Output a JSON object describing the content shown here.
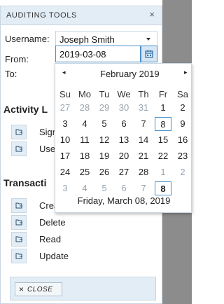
{
  "panel": {
    "title": "AUDITING TOOLS",
    "close_glyph": "×"
  },
  "form": {
    "username_label": "Username:",
    "username_value": "Joseph Smith",
    "from_label": "From:",
    "from_value": "2019-03-08",
    "to_label": "To:"
  },
  "sections": {
    "activity": {
      "title": "Activity L",
      "items": [
        "Sign",
        "Use"
      ]
    },
    "transaction": {
      "title": "Transacti",
      "items": [
        "Crea",
        "Delete",
        "Read",
        "Update"
      ]
    }
  },
  "footer": {
    "close_label": "CLOSE",
    "close_glyph": "×"
  },
  "calendar": {
    "prev_glyph": "◂",
    "next_glyph": "▸",
    "month_label": "February 2019",
    "weekdays": [
      "Su",
      "Mo",
      "Tu",
      "We",
      "Th",
      "Fr",
      "Sa"
    ],
    "weeks": [
      [
        "27",
        "28",
        "29",
        "30",
        "31",
        "1",
        "2"
      ],
      [
        "3",
        "4",
        "5",
        "6",
        "7",
        "8",
        "9"
      ],
      [
        "10",
        "11",
        "12",
        "13",
        "14",
        "15",
        "16"
      ],
      [
        "17",
        "18",
        "19",
        "20",
        "21",
        "22",
        "23"
      ],
      [
        "24",
        "25",
        "26",
        "27",
        "28",
        "1",
        "2"
      ],
      [
        "3",
        "4",
        "5",
        "6",
        "7",
        "8",
        ""
      ]
    ],
    "footer_text": "Friday, March 08, 2019"
  },
  "colors": {
    "accent": "#4a90c8",
    "header_bg": "#e3edf6",
    "overlay": "#8c8c8c"
  },
  "icons": {
    "calendar_button": "calendar-icon",
    "item_button": "log-icon",
    "close": "close-icon"
  }
}
